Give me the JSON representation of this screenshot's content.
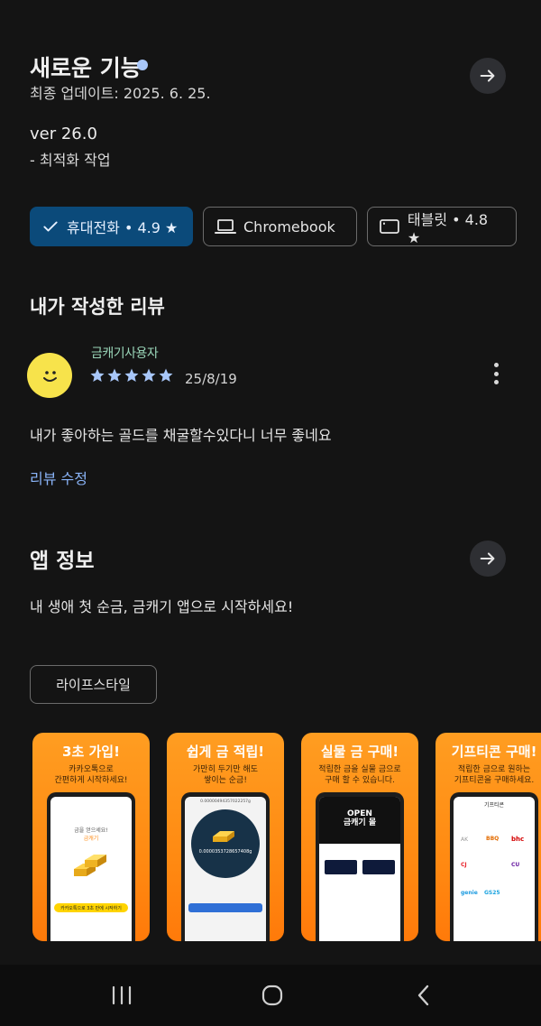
{
  "whats_new": {
    "title": "새로운 기능",
    "last_updated": "최종 업데이트: 2025. 6. 25.",
    "version": "ver 26.0",
    "note": "- 최적화 작업"
  },
  "devices": [
    {
      "label": "휴대전화 • 4.9 ★",
      "icon": "check-icon",
      "selected": true
    },
    {
      "label": "Chromebook",
      "icon": "laptop-icon",
      "selected": false
    },
    {
      "label": "태블릿 • 4.8 ★",
      "icon": "tablet-icon",
      "selected": false
    }
  ],
  "my_review": {
    "heading": "내가 작성한 리뷰",
    "reviewer": "금캐기사용자",
    "rating": 5,
    "date": "25/8/19",
    "text": "내가 좋아하는 골드를 채굴할수있다니 너무 좋네요",
    "edit_label": "리뷰 수정"
  },
  "app_info": {
    "heading": "앱 정보",
    "description": "내 생애 첫 순금, 금캐기 앱으로 시작하세요!",
    "category": "라이프스타일"
  },
  "screenshots": [
    {
      "title": "3초 가입!",
      "subtitle": "카카오톡으로\n간편하게 시작하세요!",
      "screen_title": "금을 얻으세요!",
      "screen_sub": "금캐기",
      "screen_button": "카카오톡으로 3초 만에 시작하기"
    },
    {
      "title": "쉽게 금 적립!",
      "subtitle": "가만히 두기만 해도\n쌓이는 순금!",
      "screen_value": "0.0000353728657408g",
      "screen_top": "0.00000494357022257g"
    },
    {
      "title": "실물 금 구매!",
      "subtitle": "적립한 금을 실물 금으로\n구매 할 수 있습니다.",
      "screen_banner": "OPEN\n금캐기 몰"
    },
    {
      "title": "기프티콘 구매!",
      "subtitle": "적립한 금으로 원하는\n기프티콘을 구매하세요.",
      "screen_header": "기프티콘",
      "brands": [
        "AK",
        "BBQ",
        "bhc",
        "CJ",
        "GS25",
        "CU",
        "genie"
      ]
    }
  ],
  "colors": {
    "background": "#141414",
    "accent": "#a8c7fa",
    "selected_chip": "#0b4a7a",
    "star": "#a8c7fa",
    "screenshot_orange": "#ff8a12"
  }
}
